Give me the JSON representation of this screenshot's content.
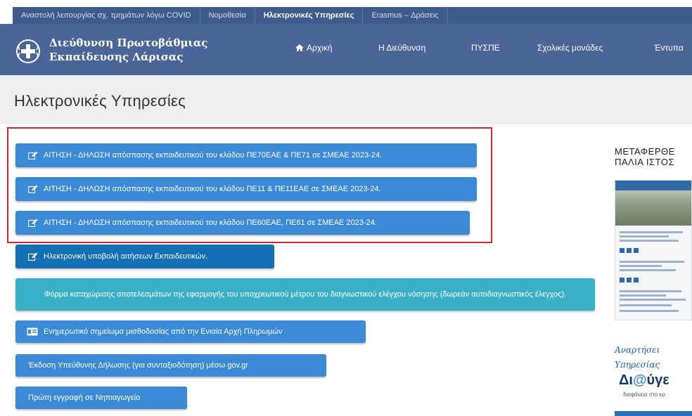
{
  "topbar": {
    "items": [
      {
        "label": "Αναστολή λειτουργίας σχ. τμημάτων λόγω COVID"
      },
      {
        "label": "Νομοθεσία"
      },
      {
        "label": "Ηλεκτρονικές Υπηρεσίες"
      },
      {
        "label": "Erasmus – Δράσεις"
      }
    ]
  },
  "header": {
    "title_line1": "Διεύθυνση Πρωτοβάθμιας",
    "title_line2": "Εκπαίδευσης Λάρισας",
    "nav": [
      {
        "label": "Αρχική",
        "icon": "home-icon"
      },
      {
        "label": "Η Διεύθυνση"
      },
      {
        "label": "ΠΥΣΠΕ"
      },
      {
        "label": "Σχολικές μονάδες"
      },
      {
        "label": "Έντυπα"
      }
    ]
  },
  "page": {
    "title": "Ηλεκτρονικές Υπηρεσίες"
  },
  "services": [
    {
      "label": "ΑΙΤΗΣΗ - ΔΗΛΩΣΗ απόσπασης εκπαιδευτικού του κλάδου ΠΕ70ΕΑΕ & ΠΕ71 σε ΣΜΕΑΕ 2023-24.",
      "icon": "edit-icon"
    },
    {
      "label": "ΑΙΤΗΣΗ - ΔΗΛΩΣΗ απόσπασης εκπαιδευτικού του κλάδου ΠΕ11 & ΠΕ11ΕΑΕ σε ΣΜΕΑΕ 2023-24.",
      "icon": "edit-icon"
    },
    {
      "label": "ΑΙΤΗΣΗ - ΔΗΛΩΣΗ απόσπασης εκπαιδευτικού του κλάδου ΠΕ60ΕΑΕ, ΠΕ61 σε ΣΜΕΑΕ 2023-24.",
      "icon": "edit-icon"
    },
    {
      "label": "Ηλεκτρονική υποβολή αιτήσεων Εκπαιδευτικών.",
      "icon": "edit-icon"
    },
    {
      "label": "Φόρμα καταχώρισης αποτελεσμάτων της εφαρμογής του υποχρεωτικού μέτρου του διαγνωστικού ελέγχου νόσησης (δωρεάν αυτοδιαγνωστικός έλεγχος)."
    },
    {
      "label": "Ενημερωτικό σημείωμα μισθοδοσίας από την Ενιαία Αρχή Πληρωμών",
      "icon": "id-card-icon"
    },
    {
      "label": "Έκδοση Υπεύθυνης Δήλωσης (για συνταξιοδότηση) μέσω gov.gr"
    },
    {
      "label": "Πρώτη εγγραφή σε Νηπιαγωγείο"
    }
  ],
  "sidebar": {
    "moved_line1": "ΜΕΤΑΦΕΡΘΕ",
    "moved_line2": "ΠΑΛΙΑ ΙΣΤΟΣ",
    "diavgeia_caption1": "Αναρτήσει",
    "diavgeia_caption2": "Υπηρεσίας",
    "diavgeia_logo_a": "Δι",
    "diavgeia_logo_at": "@",
    "diavgeia_logo_b": "ύγε",
    "diavgeia_sub": "διαφάνεια στο κρ"
  },
  "colors": {
    "topbar": "#3f5a8c",
    "header": "#4b6598",
    "button_light": "#3a8ad6",
    "button_dark": "#136fb3",
    "button_teal": "#3ab0c6",
    "highlight": "#d3282f"
  }
}
